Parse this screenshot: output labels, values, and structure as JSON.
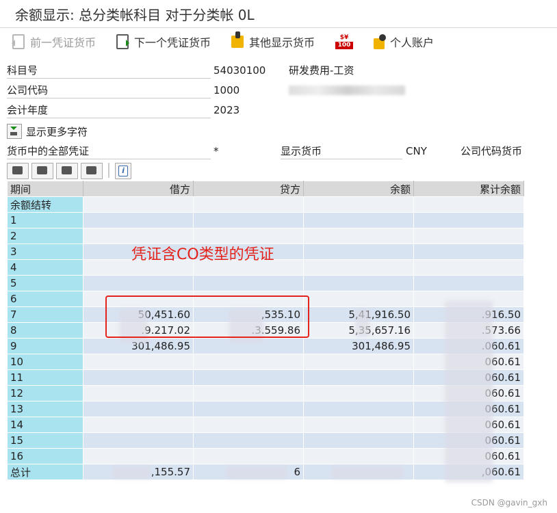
{
  "window": {
    "title": "余额显示: 总分类帐科目 对于分类帐 0L"
  },
  "toolbar": {
    "prev_label": "前一凭证货币",
    "next_label": "下一个凭证货币",
    "other_label": "其他显示货币",
    "currency_icon_top": "$¥",
    "currency_icon_bottom": "100",
    "account_label": "个人账户"
  },
  "form": {
    "account_label": "科目号",
    "account_value": "54030100",
    "account_desc": "研发费用-工资",
    "company_label": "公司代码",
    "company_value": "1000",
    "year_label": "会计年度",
    "year_value": "2023",
    "more_label": "显示更多字符",
    "all_docs_label": "货币中的全部凭证",
    "all_docs_value": "*",
    "display_currency_label": "显示货币",
    "display_currency_value": "CNY",
    "company_currency_label": "公司代码货币"
  },
  "table": {
    "headers": [
      "期间",
      "借方",
      "贷方",
      "余额",
      "累计余额"
    ],
    "rows": [
      [
        "余额结转",
        "",
        "",
        "",
        ""
      ],
      [
        "1",
        "",
        "",
        "",
        ""
      ],
      [
        "2",
        "",
        "",
        "",
        ""
      ],
      [
        "3",
        "",
        "",
        "",
        ""
      ],
      [
        "4",
        "",
        "",
        "",
        ""
      ],
      [
        "5",
        "",
        "",
        "",
        ""
      ],
      [
        "6",
        "",
        "",
        "",
        ""
      ],
      [
        "7",
        "50,451.60",
        ",535.10",
        "5,41,916.50",
        ".916.50"
      ],
      [
        "8",
        ".9.217.02",
        ".3.559.86",
        "5,35,657.16",
        ".573.66"
      ],
      [
        "9",
        "301,486.95",
        "",
        "301,486.95",
        ".060.61"
      ],
      [
        "10",
        "",
        "",
        "",
        "060.61"
      ],
      [
        "11",
        "",
        "",
        "",
        "060.61"
      ],
      [
        "12",
        "",
        "",
        "",
        "060.61"
      ],
      [
        "13",
        "",
        "",
        "",
        "060.61"
      ],
      [
        "14",
        "",
        "",
        "",
        "060.61"
      ],
      [
        "15",
        "",
        "",
        "",
        "060.61"
      ],
      [
        "16",
        "",
        "",
        "",
        "060.61"
      ],
      [
        "总计",
        ",155.57",
        "6",
        "",
        ",060.61"
      ]
    ]
  },
  "annotation": {
    "text": "凭证含CO类型的凭证"
  },
  "watermark": "CSDN @gavin_gxh"
}
